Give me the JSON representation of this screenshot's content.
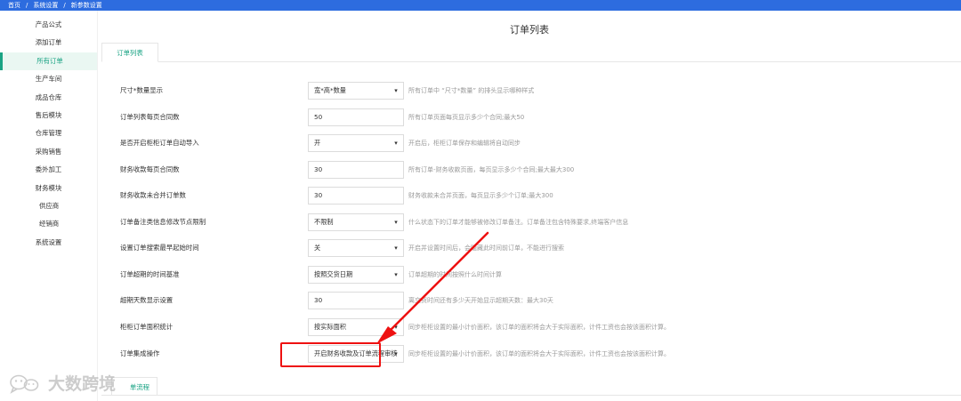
{
  "breadcrumb": {
    "home": "首页",
    "section": "系统设置",
    "page": "新参数设置",
    "separator": "/"
  },
  "sidebar": {
    "items": [
      {
        "label": "产品公式"
      },
      {
        "label": "添加订单"
      },
      {
        "label": "所有订单",
        "active": true
      },
      {
        "label": "生产车间"
      },
      {
        "label": "成品仓库"
      },
      {
        "label": "售后模块"
      },
      {
        "label": "仓库管理"
      },
      {
        "label": "采购销售"
      },
      {
        "label": "委外加工"
      },
      {
        "label": "财务模块"
      },
      {
        "label": "供应商",
        "sub": true
      },
      {
        "label": "经销商",
        "sub": true
      },
      {
        "label": "系统设置"
      }
    ]
  },
  "main": {
    "title": "订单列表",
    "tab": "订单列表",
    "bottom_tab": "单流程"
  },
  "settings": [
    {
      "label": "尺寸*数量显示",
      "type": "select",
      "value": "宽*高*数量",
      "desc": "所有订单中 “尺寸*数量” 的排头显示哪种样式"
    },
    {
      "label": "订单列表每页合同数",
      "type": "input",
      "value": "50",
      "desc": "所有订单页面每页显示多少个合同;最大50"
    },
    {
      "label": "是否开启柜柜订单自动导入",
      "type": "select",
      "value": "开",
      "desc": "开启后，柜柜订单保存和编辑将自动同步"
    },
    {
      "label": "财务收款每页合同数",
      "type": "input",
      "value": "30",
      "desc": "所有订单-财务收款页面，每页显示多少个合同;最大最大300"
    },
    {
      "label": "财务收款未合并订单数",
      "type": "input",
      "value": "30",
      "desc": "财务收款未合并页面，每页显示多少个订单;最大300"
    },
    {
      "label": "订单备注类信息修改节点限制",
      "type": "select",
      "value": "不限制",
      "desc": "什么状态下的订单才能够被修改订单备注。订单备注包含特殊要求,终端客户信息"
    },
    {
      "label": "设置订单搜索最早起始时间",
      "type": "select",
      "value": "关",
      "desc": "开启并设置时间后，会隐藏此时间前订单，不能进行搜索"
    },
    {
      "label": "订单超期的时间基准",
      "type": "select",
      "value": "按照交货日期",
      "desc": "订单超期的时间按照什么时间计算"
    },
    {
      "label": "超期天数显示设置",
      "type": "input",
      "value": "30",
      "desc": "离交货时间还有多少天开始显示超期天数：最大30天"
    },
    {
      "label": "柜柜订单面积统计",
      "type": "select",
      "value": "按实际面积",
      "desc": "同步柜柜设置的最小计价面积，该订单的面积将会大于实际面积，计件工资也会按该面积计算。"
    },
    {
      "label": "订单集成操作",
      "type": "select",
      "value": "开启财务收款及订单流程审核",
      "desc": "同步柜柜设置的最小计价面积，该订单的面积将会大于实际面积，计件工资也会按该面积计算。"
    }
  ],
  "icons": {
    "select_chevron": "chevron-down-icon",
    "watermark_logo": "wechat-logo-icon"
  },
  "watermark": {
    "text": "大数跨境"
  },
  "colors": {
    "topbar": "#2d6cdf",
    "accent": "#1aa384",
    "annotation": "#e11"
  }
}
